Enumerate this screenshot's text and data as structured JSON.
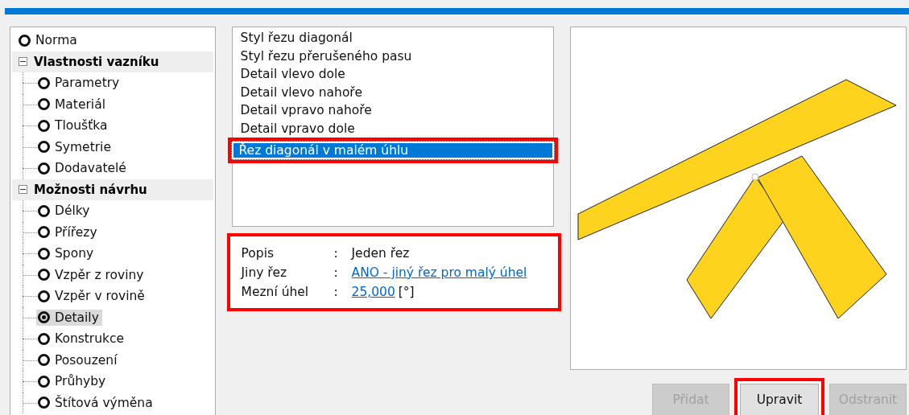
{
  "tree": [
    {
      "kind": "item",
      "label": "Norma",
      "selected": false
    },
    {
      "kind": "group",
      "label": "Vlastnosti vazníku",
      "expanded": true,
      "children": [
        {
          "label": "Parametry",
          "selected": false
        },
        {
          "label": "Materiál",
          "selected": false
        },
        {
          "label": "Tloušťka",
          "selected": false
        },
        {
          "label": "Symetrie",
          "selected": false
        },
        {
          "label": "Dodavatelé",
          "selected": false
        }
      ]
    },
    {
      "kind": "group",
      "label": "Možnosti návrhu",
      "expanded": true,
      "children": [
        {
          "label": "Délky",
          "selected": false
        },
        {
          "label": "Přířezy",
          "selected": false
        },
        {
          "label": "Spony",
          "selected": false
        },
        {
          "label": "Vzpěr z roviny",
          "selected": false
        },
        {
          "label": "Vzpěr v rovině",
          "selected": false
        },
        {
          "label": "Detaily",
          "selected": true
        },
        {
          "label": "Konstrukce",
          "selected": false
        },
        {
          "label": "Posouzení",
          "selected": false
        },
        {
          "label": "Průhyby",
          "selected": false
        },
        {
          "label": "Štítová výměna",
          "selected": false
        }
      ]
    }
  ],
  "details": [
    {
      "label": "Styl řezu diagonál",
      "selected": false,
      "highlighted": false
    },
    {
      "label": "Styl řezu přerušeného pasu",
      "selected": false,
      "highlighted": false
    },
    {
      "label": "Detail vlevo dole",
      "selected": false,
      "highlighted": false
    },
    {
      "label": "Detail vlevo nahoře",
      "selected": false,
      "highlighted": false
    },
    {
      "label": "Detail vpravo nahoře",
      "selected": false,
      "highlighted": false
    },
    {
      "label": "Detail vpravo dole",
      "selected": false,
      "highlighted": false
    },
    {
      "label": "Řez diagonál v malém úhlu",
      "selected": true,
      "highlighted": true
    }
  ],
  "properties": {
    "highlighted": true,
    "rows": [
      {
        "label": "Popis",
        "separator": ":",
        "value": "Jeden řez",
        "kind": "text"
      },
      {
        "label": "Jiny řez",
        "separator": ":",
        "value": "ANO - jiný řez pro malý úhel",
        "kind": "link"
      },
      {
        "label": "Mezní úhel",
        "separator": ":",
        "value": "25,000",
        "unit": "[°]",
        "kind": "link"
      }
    ]
  },
  "buttons": [
    {
      "label": "Přidat",
      "disabled": true,
      "highlighted": false
    },
    {
      "label": "Upravit",
      "disabled": false,
      "highlighted": true
    },
    {
      "label": "Odstranit",
      "disabled": true,
      "highlighted": false
    }
  ]
}
